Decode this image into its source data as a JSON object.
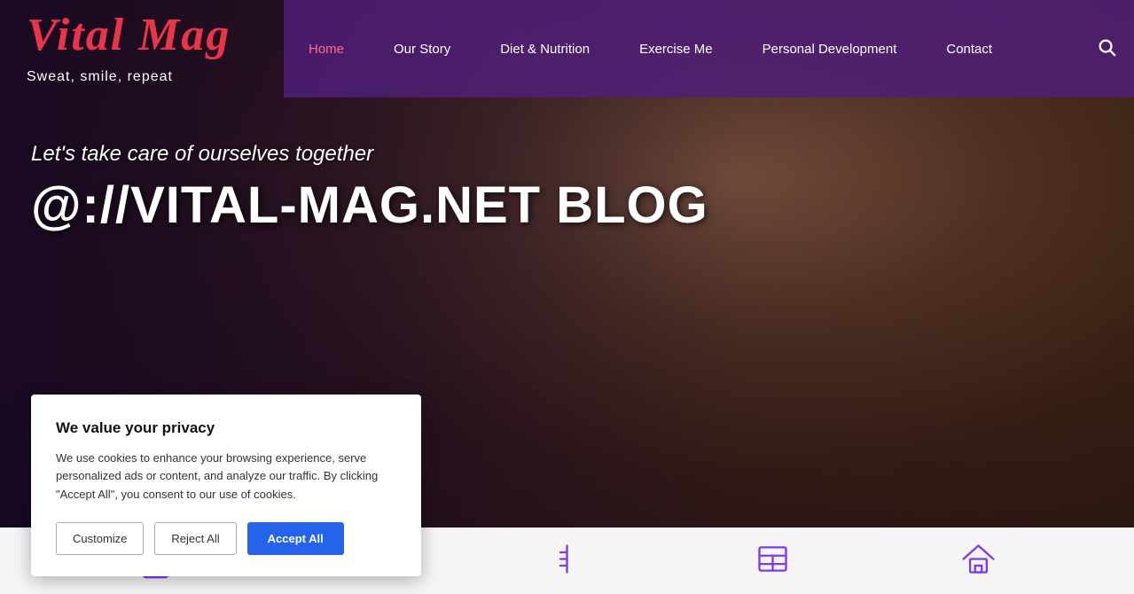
{
  "logo": {
    "name": "Vital Mag",
    "tagline": "Sweat, smile, repeat"
  },
  "navbar": {
    "links": [
      {
        "label": "Home",
        "active": true
      },
      {
        "label": "Our Story",
        "active": false
      },
      {
        "label": "Diet & Nutrition",
        "active": false
      },
      {
        "label": "Exercise Me",
        "active": false
      },
      {
        "label": "Personal Development",
        "active": false
      },
      {
        "label": "Contact",
        "active": false
      }
    ]
  },
  "hero": {
    "subtitle": "Let's take care of ourselves together",
    "title": "@://VITAL-MAG.NET BLOG"
  },
  "cookie": {
    "title": "We value your privacy",
    "body": "We use cookies to enhance your browsing experience, serve personalized ads or content, and analyze our traffic. By clicking \"Accept All\", you consent to our use of cookies.",
    "customize_label": "Customize",
    "reject_label": "Reject All",
    "accept_label": "Accept All"
  },
  "colors": {
    "accent_red": "#e8354a",
    "accent_purple": "#7c3aed",
    "nav_bg": "rgba(80,30,120,0.85)"
  }
}
